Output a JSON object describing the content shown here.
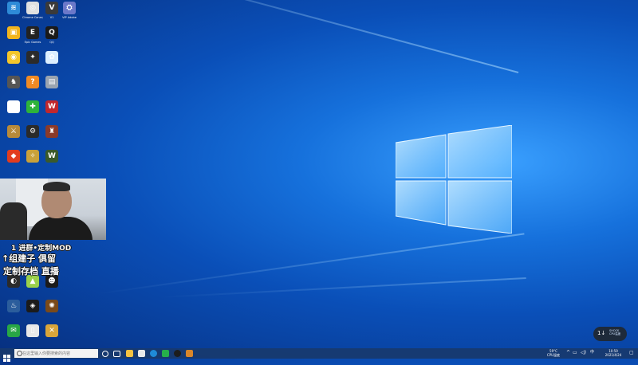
{
  "desktop": {
    "icons": [
      {
        "label": "",
        "color": "#2e8bd8",
        "glyph": "≋"
      },
      {
        "label": "Chrome Canary",
        "color": "#e0e0e0",
        "glyph": "◎"
      },
      {
        "label": "V1",
        "color": "#3a3a3a",
        "glyph": "V"
      },
      {
        "label": "VIP Adobe",
        "color": "#6b78c9",
        "glyph": "⛭"
      },
      {
        "label": "",
        "color": "#f2b51d",
        "glyph": "▣"
      },
      {
        "label": "Epic Games",
        "color": "#222222",
        "glyph": "E"
      },
      {
        "label": "QQ",
        "color": "#1a1a1a",
        "glyph": "Q"
      },
      {
        "label": "",
        "color": "#f3c62b",
        "glyph": "◉"
      },
      {
        "label": "",
        "color": "#2b2b2b",
        "glyph": "✦"
      },
      {
        "label": "",
        "color": "#dbeeff",
        "glyph": "✿"
      },
      {
        "label": "",
        "color": "#555555",
        "glyph": "♞"
      },
      {
        "label": "",
        "color": "#f08a24",
        "glyph": "?"
      },
      {
        "label": "",
        "color": "#9aa4b0",
        "glyph": "▤"
      },
      {
        "label": "",
        "color": "#ffffff",
        "glyph": "♠"
      },
      {
        "label": "",
        "color": "#2eb33a",
        "glyph": "✚"
      },
      {
        "label": "",
        "color": "#c0272d",
        "glyph": "W"
      },
      {
        "label": "",
        "color": "#b88a3a",
        "glyph": "⚔"
      },
      {
        "label": "",
        "color": "#2a2a2a",
        "glyph": "⚙"
      },
      {
        "label": "",
        "color": "#8a3a2a",
        "glyph": "♜"
      },
      {
        "label": "",
        "color": "#e23c1e",
        "glyph": "◆"
      },
      {
        "label": "",
        "color": "#c9a13a",
        "glyph": "✧"
      },
      {
        "label": "",
        "color": "#3a5a2a",
        "glyph": "W"
      },
      {
        "label": "",
        "color": "#2b2b2b",
        "glyph": "◐"
      },
      {
        "label": "",
        "color": "#9bd14b",
        "glyph": "▲"
      },
      {
        "label": "",
        "color": "#1b1b1b",
        "glyph": "☻"
      },
      {
        "label": "",
        "color": "#2b5d9c",
        "glyph": "♨"
      },
      {
        "label": "",
        "color": "#1b1b1b",
        "glyph": "◈"
      },
      {
        "label": "",
        "color": "#7a4a1a",
        "glyph": "✺"
      },
      {
        "label": "",
        "color": "#28a745",
        "glyph": "✉"
      },
      {
        "label": "",
        "color": "#e8e8e8",
        "glyph": "▯"
      },
      {
        "label": "",
        "color": "#d9a53a",
        "glyph": "✕"
      }
    ]
  },
  "overlay": {
    "line1": "1  进群•定制MOD",
    "line2": "↑组建子  俱留",
    "line3": "定制存档  直播"
  },
  "notification": {
    "text": "1↓",
    "detail": "SHOCK\nCPU温度"
  },
  "taskbar": {
    "search_placeholder": "在这里输入你要搜索的内容",
    "tray_weather": "59°C\nCPU温度",
    "clock_time": "10:59",
    "clock_date": "2021/4/24"
  },
  "colors": {
    "taskbar": "#183a6e",
    "wallpaper_accent": "#3aa0ff"
  }
}
